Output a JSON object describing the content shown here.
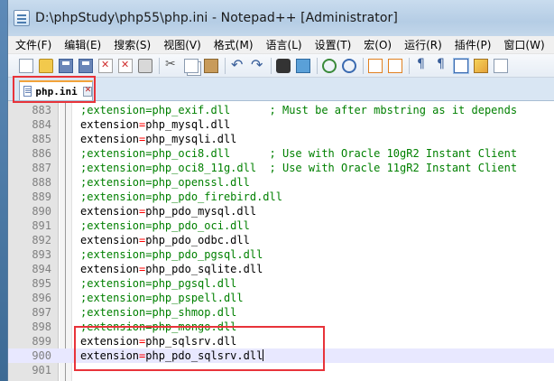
{
  "window": {
    "title": "D:\\phpStudy\\php55\\php.ini - Notepad++ [Administrator]"
  },
  "menu": [
    "文件(F)",
    "编辑(E)",
    "搜索(S)",
    "视图(V)",
    "格式(M)",
    "语言(L)",
    "设置(T)",
    "宏(O)",
    "运行(R)",
    "插件(P)",
    "窗口(W)",
    "?"
  ],
  "toolbar": {
    "icons": [
      "new-icon",
      "open-icon",
      "save-icon",
      "save-all-icon",
      "close-icon",
      "close-all-icon",
      "print-icon",
      "cut-icon",
      "copy-icon",
      "paste-icon",
      "undo-icon",
      "redo-icon",
      "find-icon",
      "replace-icon",
      "zoom-in-icon",
      "zoom-out-icon",
      "sync-vertical-icon",
      "sync-horizontal-icon",
      "word-wrap-icon",
      "show-all-chars-icon",
      "indent-guide-icon",
      "doc-map-icon",
      "function-list-icon"
    ]
  },
  "tab": {
    "label": "php.ini"
  },
  "editor": {
    "lines": [
      {
        "num": "883",
        "pre": ";extension",
        "eq": "=",
        "post": "php_exif.dll      ; Must be after mbstring as it depends",
        "comment": true
      },
      {
        "num": "884",
        "pre": "extension",
        "eq": "=",
        "post": "php_mysql.dll",
        "comment": false
      },
      {
        "num": "885",
        "pre": "extension",
        "eq": "=",
        "post": "php_mysqli.dll",
        "comment": false
      },
      {
        "num": "886",
        "pre": ";extension",
        "eq": "=",
        "post": "php_oci8.dll      ; Use with Oracle 10gR2 Instant Client",
        "comment": true
      },
      {
        "num": "887",
        "pre": ";extension",
        "eq": "=",
        "post": "php_oci8_11g.dll  ; Use with Oracle 11gR2 Instant Client",
        "comment": true
      },
      {
        "num": "888",
        "pre": ";extension",
        "eq": "=",
        "post": "php_openssl.dll",
        "comment": true
      },
      {
        "num": "889",
        "pre": ";extension",
        "eq": "=",
        "post": "php_pdo_firebird.dll",
        "comment": true
      },
      {
        "num": "890",
        "pre": "extension",
        "eq": "=",
        "post": "php_pdo_mysql.dll",
        "comment": false
      },
      {
        "num": "891",
        "pre": ";extension",
        "eq": "=",
        "post": "php_pdo_oci.dll",
        "comment": true
      },
      {
        "num": "892",
        "pre": "extension",
        "eq": "=",
        "post": "php_pdo_odbc.dll",
        "comment": false
      },
      {
        "num": "893",
        "pre": ";extension",
        "eq": "=",
        "post": "php_pdo_pgsql.dll",
        "comment": true
      },
      {
        "num": "894",
        "pre": "extension",
        "eq": "=",
        "post": "php_pdo_sqlite.dll",
        "comment": false
      },
      {
        "num": "895",
        "pre": ";extension",
        "eq": "=",
        "post": "php_pgsql.dll",
        "comment": true
      },
      {
        "num": "896",
        "pre": ";extension",
        "eq": "=",
        "post": "php_pspell.dll",
        "comment": true
      },
      {
        "num": "897",
        "pre": ";extension",
        "eq": "=",
        "post": "php_shmop.dll",
        "comment": true
      },
      {
        "num": "898",
        "pre": ";extension",
        "eq": "=",
        "post": "php_mongo.dll",
        "comment": true
      },
      {
        "num": "899",
        "pre": "extension",
        "eq": "=",
        "post": "php_sqlsrv.dll",
        "comment": false
      },
      {
        "num": "900",
        "pre": "extension",
        "eq": "=",
        "post": "php_pdo_sqlsrv.dll",
        "comment": false,
        "current": true
      },
      {
        "num": "901",
        "pre": "",
        "eq": "",
        "post": "",
        "comment": false
      }
    ]
  }
}
